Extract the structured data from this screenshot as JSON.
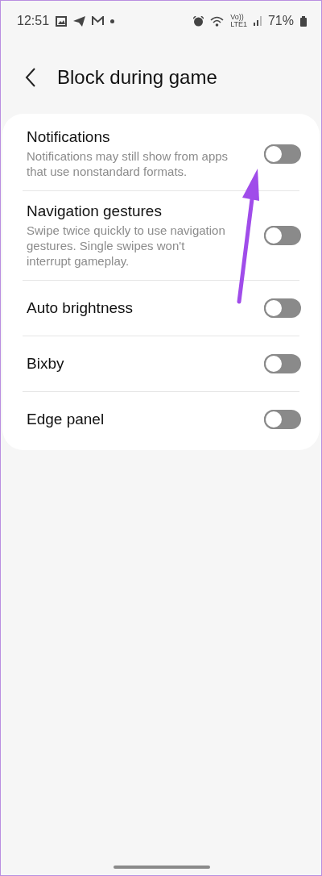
{
  "status_bar": {
    "time": "12:51",
    "volte_top": "Vo))",
    "volte_bottom": "LTE1",
    "battery": "71%"
  },
  "header": {
    "title": "Block during game"
  },
  "settings": [
    {
      "label": "Notifications",
      "description": "Notifications may still show from apps that use nonstandard formats.",
      "on": false
    },
    {
      "label": "Navigation gestures",
      "description": "Swipe twice quickly to use navigation gestures. Single swipes won't interrupt gameplay.",
      "on": false
    },
    {
      "label": "Auto brightness",
      "on": false
    },
    {
      "label": "Bixby",
      "on": false
    },
    {
      "label": "Edge panel",
      "on": false
    }
  ]
}
